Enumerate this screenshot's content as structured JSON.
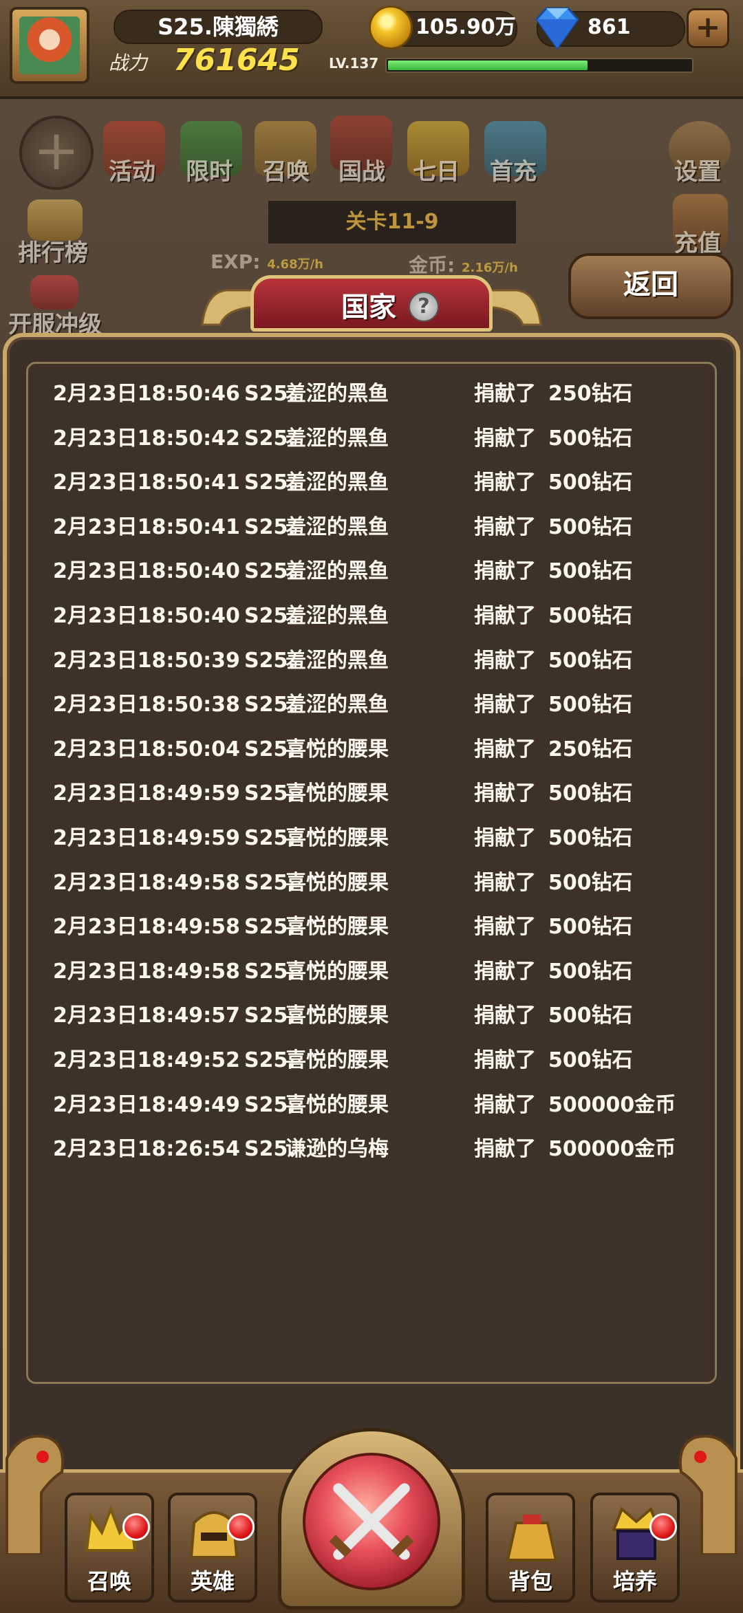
{
  "header": {
    "player_name": "S25.陳獨綉",
    "power_label": "战力",
    "power_value": "761645",
    "gold": "105.90万",
    "diamonds": "861",
    "level": "LV.137",
    "exp_fraction": 0.66
  },
  "main_menu": {
    "items": [
      "活动",
      "限时",
      "召唤",
      "国战",
      "七日",
      "首充"
    ],
    "settings": "设置",
    "recharge": "充值",
    "ranking": "排行榜",
    "server_rush": "开服冲级"
  },
  "stage": {
    "name": "关卡11-9",
    "exp_label": "EXP:",
    "exp_rate": "4.68万/h",
    "gold_label": "金币:",
    "gold_rate": "2.16万/h"
  },
  "return_label": "返回",
  "panel": {
    "title": "国家",
    "help": "?",
    "log": [
      {
        "time": "2月23日18:50:46",
        "server": "S25.",
        "name": "羞涩的黑鱼",
        "verb": "捐献了",
        "amount": "250钻石"
      },
      {
        "time": "2月23日18:50:42",
        "server": "S25.",
        "name": "羞涩的黑鱼",
        "verb": "捐献了",
        "amount": "500钻石"
      },
      {
        "time": "2月23日18:50:41",
        "server": "S25.",
        "name": "羞涩的黑鱼",
        "verb": "捐献了",
        "amount": "500钻石"
      },
      {
        "time": "2月23日18:50:41",
        "server": "S25.",
        "name": "羞涩的黑鱼",
        "verb": "捐献了",
        "amount": "500钻石"
      },
      {
        "time": "2月23日18:50:40",
        "server": "S25.",
        "name": "羞涩的黑鱼",
        "verb": "捐献了",
        "amount": "500钻石"
      },
      {
        "time": "2月23日18:50:40",
        "server": "S25.",
        "name": "羞涩的黑鱼",
        "verb": "捐献了",
        "amount": "500钻石"
      },
      {
        "time": "2月23日18:50:39",
        "server": "S25.",
        "name": "羞涩的黑鱼",
        "verb": "捐献了",
        "amount": "500钻石"
      },
      {
        "time": "2月23日18:50:38",
        "server": "S25.",
        "name": "羞涩的黑鱼",
        "verb": "捐献了",
        "amount": "500钻石"
      },
      {
        "time": "2月23日18:50:04",
        "server": "S25.",
        "name": "喜悦的腰果",
        "verb": "捐献了",
        "amount": "250钻石"
      },
      {
        "time": "2月23日18:49:59",
        "server": "S25.",
        "name": "喜悦的腰果",
        "verb": "捐献了",
        "amount": "500钻石"
      },
      {
        "time": "2月23日18:49:59",
        "server": "S25.",
        "name": "喜悦的腰果",
        "verb": "捐献了",
        "amount": "500钻石"
      },
      {
        "time": "2月23日18:49:58",
        "server": "S25.",
        "name": "喜悦的腰果",
        "verb": "捐献了",
        "amount": "500钻石"
      },
      {
        "time": "2月23日18:49:58",
        "server": "S25.",
        "name": "喜悦的腰果",
        "verb": "捐献了",
        "amount": "500钻石"
      },
      {
        "time": "2月23日18:49:58",
        "server": "S25.",
        "name": "喜悦的腰果",
        "verb": "捐献了",
        "amount": "500钻石"
      },
      {
        "time": "2月23日18:49:57",
        "server": "S25.",
        "name": "喜悦的腰果",
        "verb": "捐献了",
        "amount": "500钻石"
      },
      {
        "time": "2月23日18:49:52",
        "server": "S25.",
        "name": "喜悦的腰果",
        "verb": "捐献了",
        "amount": "500钻石"
      },
      {
        "time": "2月23日18:49:49",
        "server": "S25.",
        "name": "喜悦的腰果",
        "verb": "捐献了",
        "amount": "500000金币"
      },
      {
        "time": "2月23日18:26:54",
        "server": "S25.",
        "name": "谦逊的乌梅",
        "verb": "捐献了",
        "amount": "500000金币"
      }
    ]
  },
  "bottom_nav": {
    "summon": "召唤",
    "heroes": "英雄",
    "bag": "背包",
    "train": "培养"
  },
  "colors": {
    "power": "#ffe14a",
    "exp_fill": "#3ab43a",
    "title_tab": "#b8343a",
    "panel_border": "#c9a86a",
    "notification": "#e01818"
  }
}
